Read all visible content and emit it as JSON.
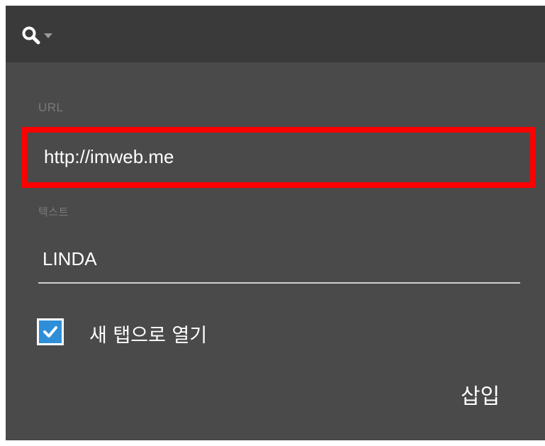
{
  "toolbar": {
    "search_icon": "search-icon",
    "dropdown_icon": "caret-down-icon"
  },
  "form": {
    "url": {
      "label": "URL",
      "value": "http://imweb.me",
      "highlight_color": "#ff0000"
    },
    "text": {
      "label": "텍스트",
      "value": "LINDA"
    },
    "open_new_tab": {
      "label": "새 탭으로 열기",
      "checked": true,
      "check_color": "#2e8fd8"
    },
    "insert_label": "삽입"
  },
  "colors": {
    "panel": "#4a4a4a",
    "header": "#3a3a3a",
    "label": "#7a7a7a",
    "text": "#ffffff"
  }
}
